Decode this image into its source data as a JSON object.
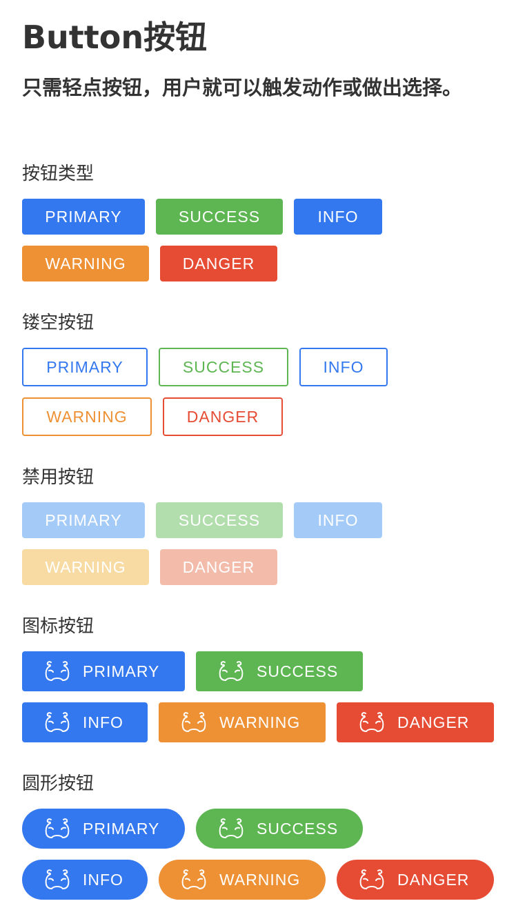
{
  "page": {
    "title": "Button按钮",
    "description": "只需轻点按钮，用户就可以触发动作或做出选择。"
  },
  "sections": {
    "types": {
      "label": "按钮类型"
    },
    "plain": {
      "label": "镂空按钮"
    },
    "disabled": {
      "label": "禁用按钮"
    },
    "icon": {
      "label": "图标按钮"
    },
    "round": {
      "label": "圆形按钮"
    }
  },
  "buttons": {
    "primary": "PRIMARY",
    "success": "SUCCESS",
    "info": "INFO",
    "warning": "WARNING",
    "danger": "DANGER"
  },
  "icon_name": "flexed-biceps-icon",
  "colors": {
    "primary": "#3478f0",
    "success": "#5db652",
    "info": "#3478f0",
    "warning": "#ee9034",
    "danger": "#e64b34"
  }
}
